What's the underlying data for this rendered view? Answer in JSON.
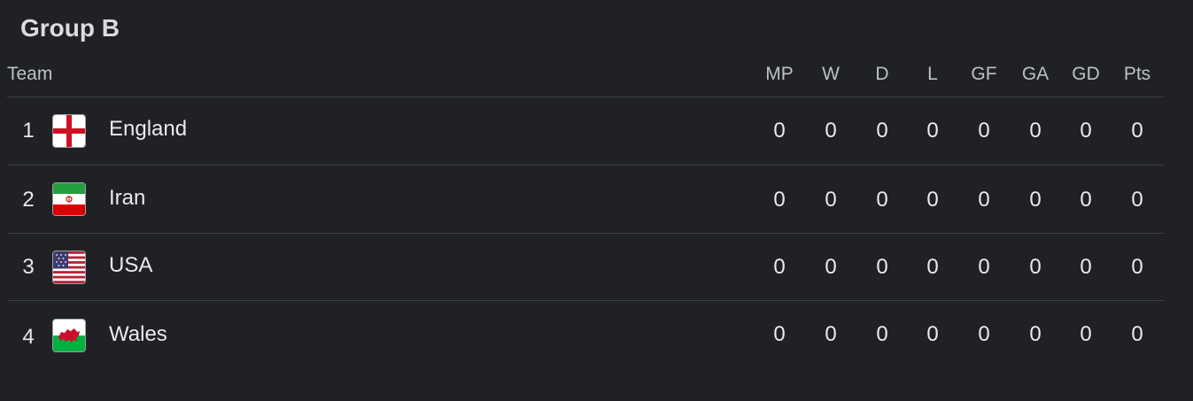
{
  "group": {
    "title": "Group B"
  },
  "columns": {
    "team": "Team",
    "stats": [
      "MP",
      "W",
      "D",
      "L",
      "GF",
      "GA",
      "GD",
      "Pts"
    ]
  },
  "teams": [
    {
      "rank": "1",
      "name": "England",
      "flag_icon": "england-flag-icon",
      "stats": [
        "0",
        "0",
        "0",
        "0",
        "0",
        "0",
        "0",
        "0"
      ]
    },
    {
      "rank": "2",
      "name": "Iran",
      "flag_icon": "iran-flag-icon",
      "stats": [
        "0",
        "0",
        "0",
        "0",
        "0",
        "0",
        "0",
        "0"
      ]
    },
    {
      "rank": "3",
      "name": "USA",
      "flag_icon": "usa-flag-icon",
      "stats": [
        "0",
        "0",
        "0",
        "0",
        "0",
        "0",
        "0",
        "0"
      ]
    },
    {
      "rank": "4",
      "name": "Wales",
      "flag_icon": "wales-flag-icon",
      "stats": [
        "0",
        "0",
        "0",
        "0",
        "0",
        "0",
        "0",
        "0"
      ]
    }
  ],
  "colors": {
    "background": "#202124",
    "divider": "#3c4043",
    "text": "#e8eaed",
    "muted": "#bdc1c6"
  }
}
